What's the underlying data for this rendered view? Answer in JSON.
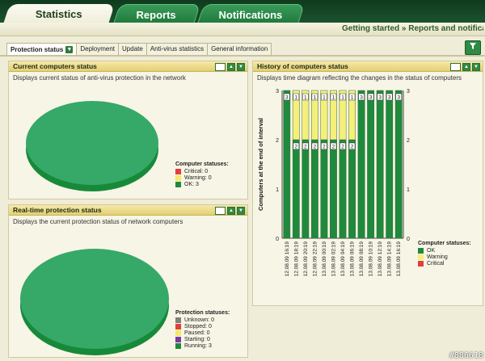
{
  "top_tabs": [
    {
      "label": "Statistics",
      "active": true
    },
    {
      "label": "Reports",
      "active": false
    },
    {
      "label": "Notifications",
      "active": false
    }
  ],
  "breadcrumb": "Getting started » Reports and notifica",
  "sub_tabs": [
    {
      "label": "Protection status",
      "active": true
    },
    {
      "label": "Deployment"
    },
    {
      "label": "Update"
    },
    {
      "label": "Anti-virus statistics"
    },
    {
      "label": "General information"
    }
  ],
  "panels": {
    "current": {
      "title": "Current computers status",
      "description": "Displays current status of anti-virus protection in the network",
      "legend_title": "Computer statuses:",
      "legend": [
        {
          "label": "Critical: 0",
          "color": "#e0403a"
        },
        {
          "label": "Warning: 0",
          "color": "#f5e86a"
        },
        {
          "label": "OK: 3",
          "color": "#1f8a3c"
        }
      ]
    },
    "realtime": {
      "title": "Real-time protection status",
      "description": "Displays the current protection status of network computers",
      "legend_title": "Protection statuses:",
      "legend": [
        {
          "label": "Unknown: 0",
          "color": "#808080"
        },
        {
          "label": "Stopped: 0",
          "color": "#e0403a"
        },
        {
          "label": "Paused: 0",
          "color": "#f5e86a"
        },
        {
          "label": "Starting: 0",
          "color": "#7a3aa0"
        },
        {
          "label": "Running: 3",
          "color": "#1f8a3c"
        }
      ]
    },
    "history": {
      "title": "History of computers status",
      "description": "Displays time diagram reflecting the changes in the status of computers",
      "legend_title": "Computer statuses:",
      "legend": [
        {
          "label": "OK",
          "color": "#1f8a3c"
        },
        {
          "label": "Warning",
          "color": "#f5f07a"
        },
        {
          "label": "Critical",
          "color": "#e0403a"
        }
      ]
    }
  },
  "chart_data": [
    {
      "type": "pie",
      "categories": [
        "Critical",
        "Warning",
        "OK"
      ],
      "values": [
        0,
        0,
        3
      ]
    },
    {
      "type": "pie",
      "categories": [
        "Unknown",
        "Stopped",
        "Paused",
        "Starting",
        "Running"
      ],
      "values": [
        0,
        0,
        0,
        0,
        3
      ]
    },
    {
      "type": "bar",
      "stacked": true,
      "categories": [
        "12.08.09 16:19",
        "12.08.09 18:19",
        "12.08.09 20:19",
        "12.08.09 22:19",
        "13.08.09 00:19",
        "13.08.09 02:19",
        "13.08.09 04:19",
        "13.08.09 06:19",
        "13.08.09 08:19",
        "13.08.09 10:19",
        "13.08.09 12:19",
        "13.08.09 14:19",
        "13.08.09 16:19"
      ],
      "series": [
        {
          "name": "OK",
          "values": [
            3,
            2,
            2,
            2,
            2,
            2,
            2,
            2,
            3,
            3,
            3,
            3,
            3
          ]
        },
        {
          "name": "Warning",
          "values": [
            0,
            1,
            1,
            1,
            1,
            1,
            1,
            1,
            0,
            0,
            0,
            0,
            0
          ]
        },
        {
          "name": "Critical",
          "values": [
            0,
            0,
            0,
            0,
            0,
            0,
            0,
            0,
            0,
            0,
            0,
            0,
            0
          ]
        }
      ],
      "ylabel": "Computers at the end of interval",
      "ylim": [
        0,
        3
      ],
      "yticks": [
        "0",
        "1",
        "2",
        "3"
      ]
    }
  ],
  "watermark": "#886618"
}
